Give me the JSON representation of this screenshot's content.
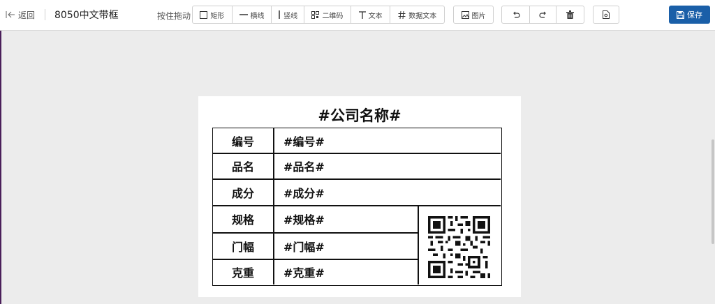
{
  "toolbar": {
    "back_label": "返回",
    "title": "8050中文带框",
    "drag_hint": "按住拖动",
    "tools": {
      "rect": "矩形",
      "hline": "横线",
      "vline": "竖线",
      "qrcode": "二维码",
      "text": "文本",
      "datatext": "数据文本"
    },
    "image_label": "图片",
    "save_label": "保存"
  },
  "label": {
    "company": "#公司名称#",
    "rows": [
      {
        "key": "编号",
        "value": "#编号#"
      },
      {
        "key": "品名",
        "value": "#品名#"
      },
      {
        "key": "成分",
        "value": "#成分#"
      },
      {
        "key": "规格",
        "value": "#规格#"
      },
      {
        "key": "门幅",
        "value": "#门幅#"
      },
      {
        "key": "克重",
        "value": "#克重#"
      }
    ]
  },
  "colors": {
    "primary": "#1a5fa8",
    "canvas_bg": "#ececec"
  }
}
